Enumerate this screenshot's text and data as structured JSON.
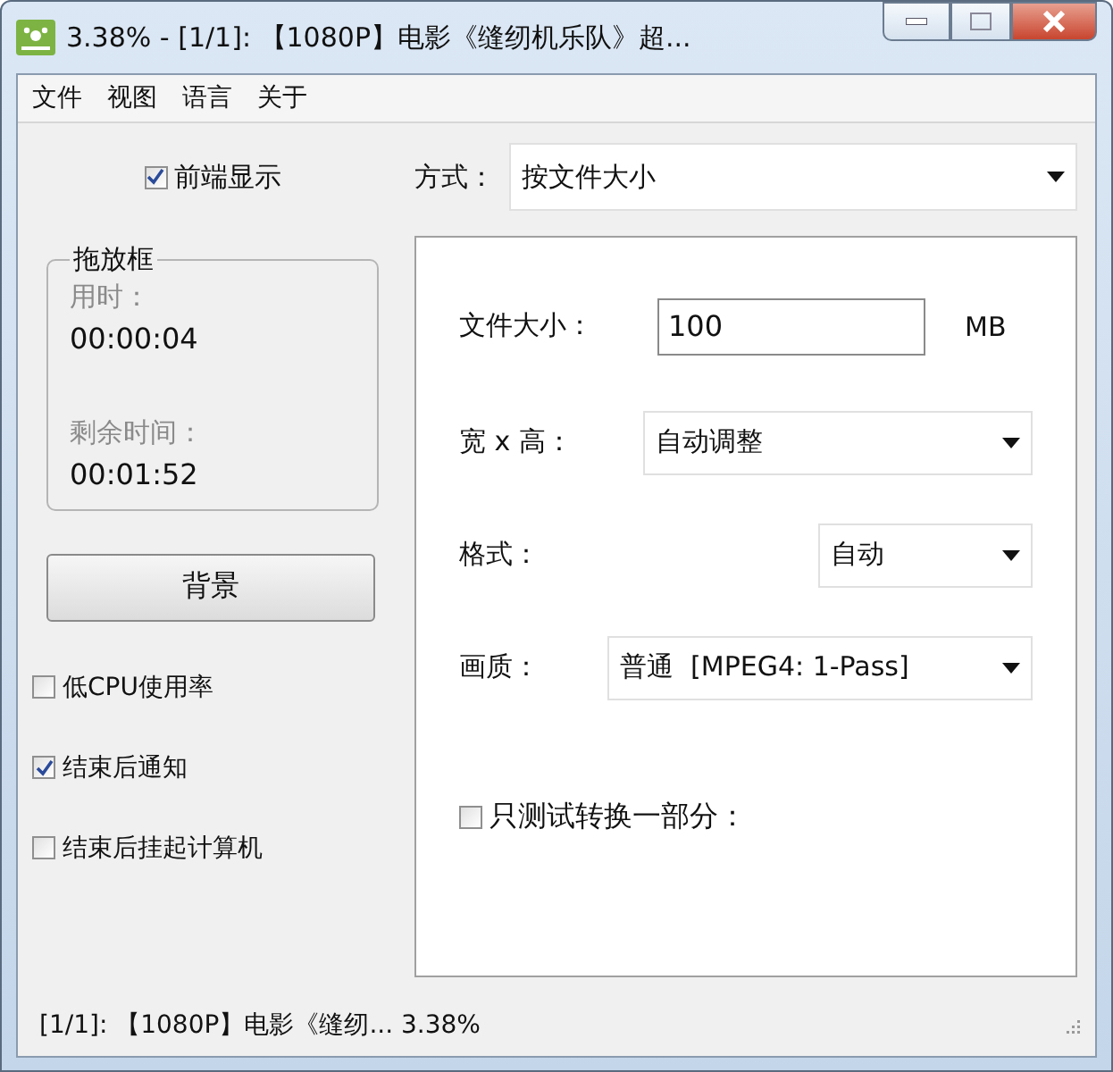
{
  "window": {
    "title": "3.38% - [1/1]: 【1080P】电影《缝纫机乐队》超..."
  },
  "menu": [
    "文件",
    "视图",
    "语言",
    "关于"
  ],
  "always_on_top": {
    "label": "前端显示",
    "checked": true
  },
  "mode": {
    "label": "方式：",
    "value": "按文件大小"
  },
  "drop_box": {
    "title": "拖放框",
    "elapsed_label": "用时：",
    "elapsed": "00:00:04",
    "remaining_label": "剩余时间：",
    "remaining": "00:01:52"
  },
  "background_button": "背景",
  "options": [
    {
      "label": "低CPU使用率",
      "checked": false
    },
    {
      "label": "结束后通知",
      "checked": true
    },
    {
      "label": "结束后挂起计算机",
      "checked": false
    }
  ],
  "settings": {
    "file_size": {
      "label": "文件大小：",
      "value": "100",
      "unit": "MB"
    },
    "dimensions": {
      "label": "宽 x 高：",
      "value": "自动调整"
    },
    "format": {
      "label": "格式：",
      "value": "自动"
    },
    "quality": {
      "label": "画质：",
      "value": "普通  [MPEG4: 1-Pass]"
    },
    "test_part": {
      "label": "只测试转换一部分：",
      "checked": false
    }
  },
  "status_bar": "[1/1]: 【1080P】电影《缝纫... 3.38%"
}
